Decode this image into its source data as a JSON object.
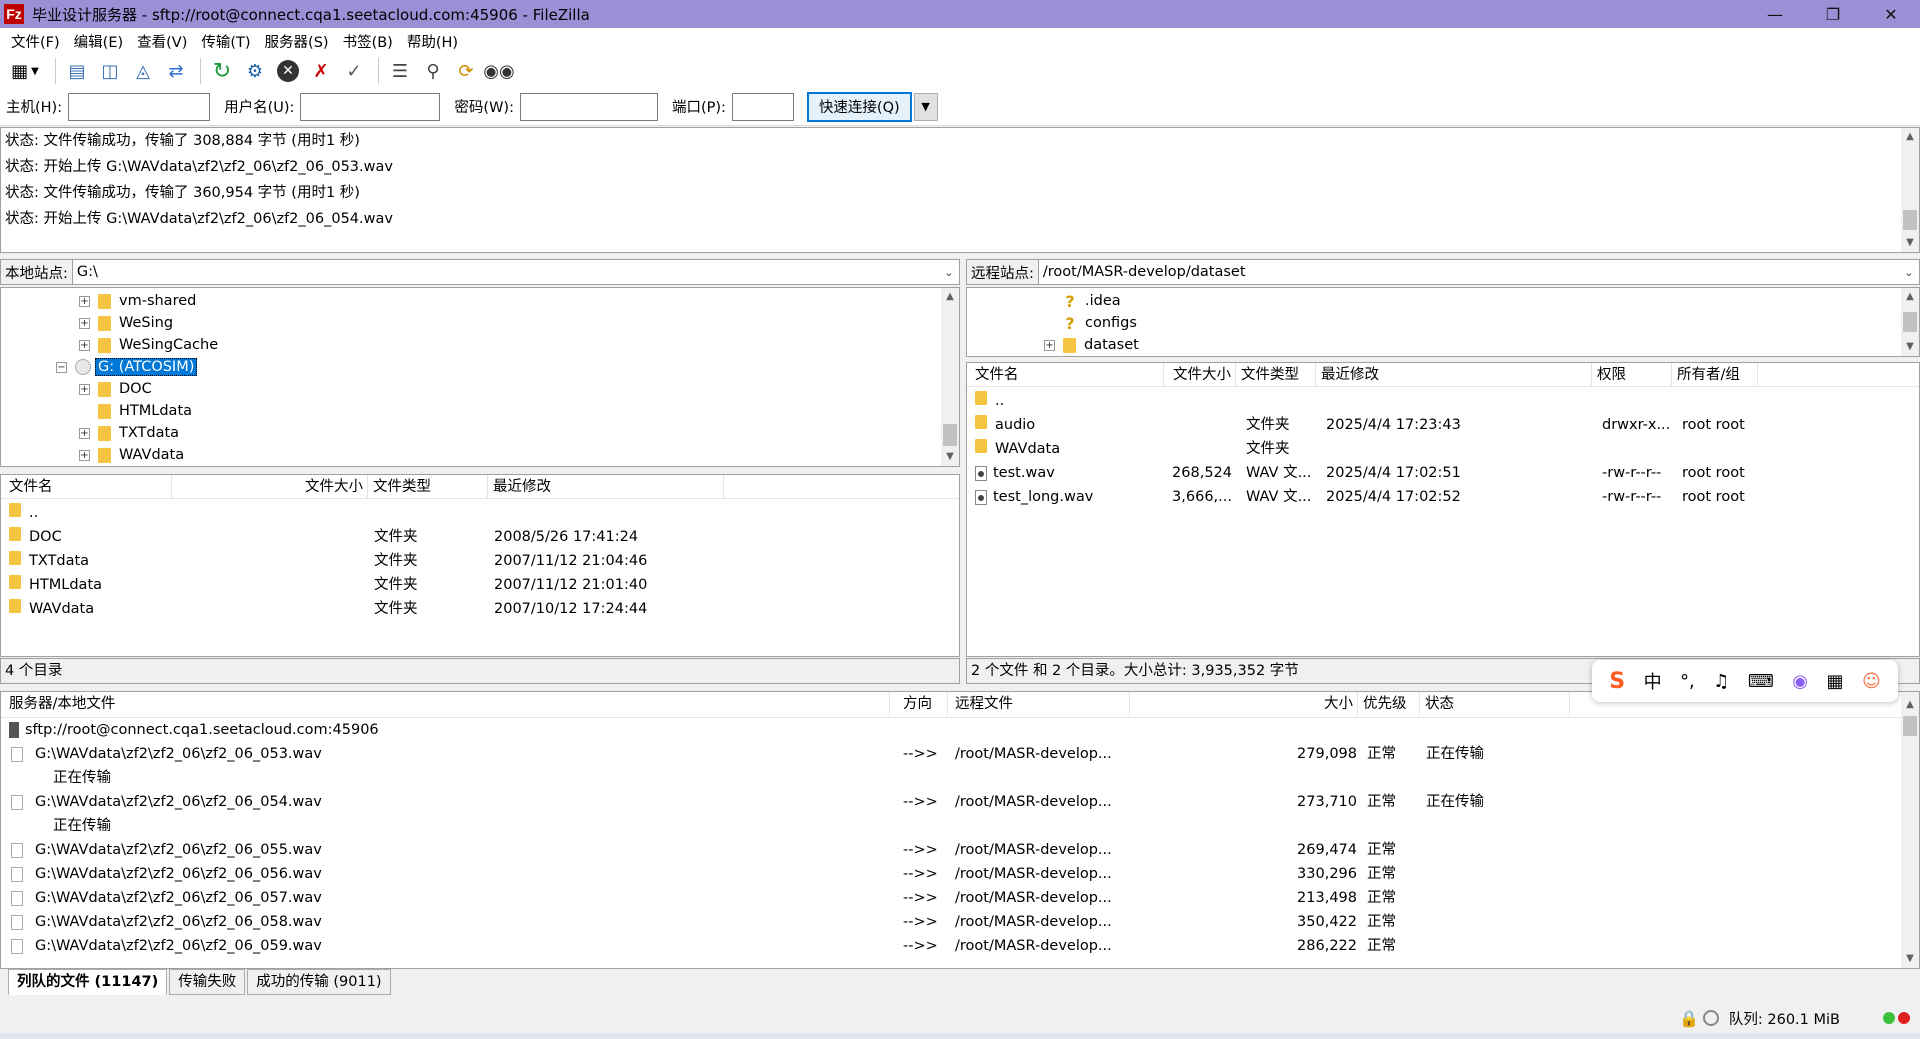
{
  "window": {
    "title": "毕业设计服务器 - sftp://root@connect.cqa1.seetacloud.com:45906 - FileZilla",
    "logo": "Fz",
    "controls": [
      "minimize-icon",
      "restore-icon",
      "close-icon"
    ]
  },
  "menu": [
    "文件(F)",
    "编辑(E)",
    "查看(V)",
    "传输(T)",
    "服务器(S)",
    "书签(B)",
    "帮助(H)"
  ],
  "toolbar": {
    "icons": [
      "site-manager-icon",
      "toggle-log-icon",
      "toggle-local-tree-icon",
      "toggle-remote-tree-icon",
      "toggle-queue-icon",
      "refresh-icon",
      "process-queue-icon",
      "cancel-icon",
      "disconnect-icon",
      "reconnect-icon",
      "filter-icon",
      "compare-icon",
      "sync-browse-icon",
      "search-icon"
    ]
  },
  "quickconnect": {
    "host_label": "主机(H):",
    "user_label": "用户名(U):",
    "pass_label": "密码(W):",
    "port_label": "端口(P):",
    "button_label": "快速连接(Q)",
    "host_value": "",
    "user_value": "",
    "pass_value": "",
    "port_value": ""
  },
  "log": [
    "状态: 文件传输成功，传输了 308,884 字节 (用时1 秒)",
    "状态: 开始上传 G:\\WAVdata\\zf2\\zf2_06\\zf2_06_053.wav",
    "状态: 文件传输成功，传输了 360,954 字节 (用时1 秒)",
    "状态: 开始上传 G:\\WAVdata\\zf2\\zf2_06\\zf2_06_054.wav"
  ],
  "local": {
    "site_label": "本地站点:",
    "path": "G:\\",
    "tree": [
      {
        "label": "vm-shared",
        "expandable": true,
        "depth": 2
      },
      {
        "label": "WeSing",
        "expandable": true,
        "depth": 2
      },
      {
        "label": "WeSingCache",
        "expandable": true,
        "depth": 2
      },
      {
        "label": "G: (ATCOSIM)",
        "expandable": true,
        "depth": 1,
        "selected": true
      },
      {
        "label": "DOC",
        "expandable": true,
        "depth": 2
      },
      {
        "label": "HTMLdata",
        "expandable": false,
        "depth": 2
      },
      {
        "label": "TXTdata",
        "expandable": true,
        "depth": 2
      },
      {
        "label": "WAVdata",
        "expandable": true,
        "depth": 2
      }
    ],
    "columns": [
      "文件名",
      "文件大小",
      "文件类型",
      "最近修改"
    ],
    "rows": [
      {
        "name": "..",
        "size": "",
        "type": "",
        "modified": ""
      },
      {
        "name": "DOC",
        "size": "",
        "type": "文件夹",
        "modified": "2008/5/26 17:41:24"
      },
      {
        "name": "TXTdata",
        "size": "",
        "type": "文件夹",
        "modified": "2007/11/12 21:04:46"
      },
      {
        "name": "HTMLdata",
        "size": "",
        "type": "文件夹",
        "modified": "2007/11/12 21:01:40"
      },
      {
        "name": "WAVdata",
        "size": "",
        "type": "文件夹",
        "modified": "2007/10/12 17:24:44"
      }
    ],
    "status": "4 个目录"
  },
  "remote": {
    "site_label": "远程站点:",
    "path": "/root/MASR-develop/dataset",
    "tree": [
      {
        "label": ".idea",
        "icon": "question-icon",
        "expandable": false
      },
      {
        "label": "configs",
        "icon": "question-icon",
        "expandable": false
      },
      {
        "label": "dataset",
        "icon": "folder-icon",
        "expandable": true
      }
    ],
    "columns": [
      "文件名",
      "文件大小",
      "文件类型",
      "最近修改",
      "权限",
      "所有者/组"
    ],
    "rows": [
      {
        "name": "..",
        "size": "",
        "type": "",
        "modified": "",
        "perm": "",
        "owner": "",
        "icon": "folder"
      },
      {
        "name": "audio",
        "size": "",
        "type": "文件夹",
        "modified": "2025/4/4 17:23:43",
        "perm": "drwxr-x...",
        "owner": "root root",
        "icon": "folder"
      },
      {
        "name": "WAVdata",
        "size": "",
        "type": "文件夹",
        "modified": "",
        "perm": "",
        "owner": "",
        "icon": "folder"
      },
      {
        "name": "test.wav",
        "size": "268,524",
        "type": "WAV 文...",
        "modified": "2025/4/4 17:02:51",
        "perm": "-rw-r--r--",
        "owner": "root root",
        "icon": "file"
      },
      {
        "name": "test_long.wav",
        "size": "3,666,...",
        "type": "WAV 文...",
        "modified": "2025/4/4 17:02:52",
        "perm": "-rw-r--r--",
        "owner": "root root",
        "icon": "file"
      }
    ],
    "status": "2 个文件 和 2 个目录。大小总计: 3,935,352 字节"
  },
  "queue": {
    "columns": [
      "服务器/本地文件",
      "方向",
      "远程文件",
      "大小",
      "优先级",
      "状态"
    ],
    "server": "sftp://root@connect.cqa1.seetacloud.com:45906",
    "rows": [
      {
        "local": "G:\\WAVdata\\zf2\\zf2_06\\zf2_06_053.wav",
        "dir": "-->>",
        "remote": "/root/MASR-develop...",
        "size": "279,098",
        "priority": "正常",
        "status": "正在传输",
        "sub": "正在传输"
      },
      {
        "local": "G:\\WAVdata\\zf2\\zf2_06\\zf2_06_054.wav",
        "dir": "-->>",
        "remote": "/root/MASR-develop...",
        "size": "273,710",
        "priority": "正常",
        "status": "正在传输",
        "sub": "正在传输"
      },
      {
        "local": "G:\\WAVdata\\zf2\\zf2_06\\zf2_06_055.wav",
        "dir": "-->>",
        "remote": "/root/MASR-develop...",
        "size": "269,474",
        "priority": "正常",
        "status": "",
        "sub": ""
      },
      {
        "local": "G:\\WAVdata\\zf2\\zf2_06\\zf2_06_056.wav",
        "dir": "-->>",
        "remote": "/root/MASR-develop...",
        "size": "330,296",
        "priority": "正常",
        "status": "",
        "sub": ""
      },
      {
        "local": "G:\\WAVdata\\zf2\\zf2_06\\zf2_06_057.wav",
        "dir": "-->>",
        "remote": "/root/MASR-develop...",
        "size": "213,498",
        "priority": "正常",
        "status": "",
        "sub": ""
      },
      {
        "local": "G:\\WAVdata\\zf2\\zf2_06\\zf2_06_058.wav",
        "dir": "-->>",
        "remote": "/root/MASR-develop...",
        "size": "350,422",
        "priority": "正常",
        "status": "",
        "sub": ""
      },
      {
        "local": "G:\\WAVdata\\zf2\\zf2_06\\zf2_06_059.wav",
        "dir": "-->>",
        "remote": "/root/MASR-develop...",
        "size": "286,222",
        "priority": "正常",
        "status": "",
        "sub": ""
      }
    ],
    "tabs": [
      "列队的文件 (11147)",
      "传输失败",
      "成功的传输 (9011)"
    ]
  },
  "statusbar": {
    "queue_text": "队列: 260.1 MiB"
  },
  "ime": {
    "logo": "S",
    "lang": "中",
    "punct": "°,",
    "icons": [
      "mic-icon",
      "keyboard-icon",
      "skin-icon",
      "toolbox-icon",
      "mascot-icon"
    ]
  },
  "colors": {
    "titlebar": "#9b8fd6",
    "selection": "#0078d7",
    "folder": "#f5c542"
  }
}
